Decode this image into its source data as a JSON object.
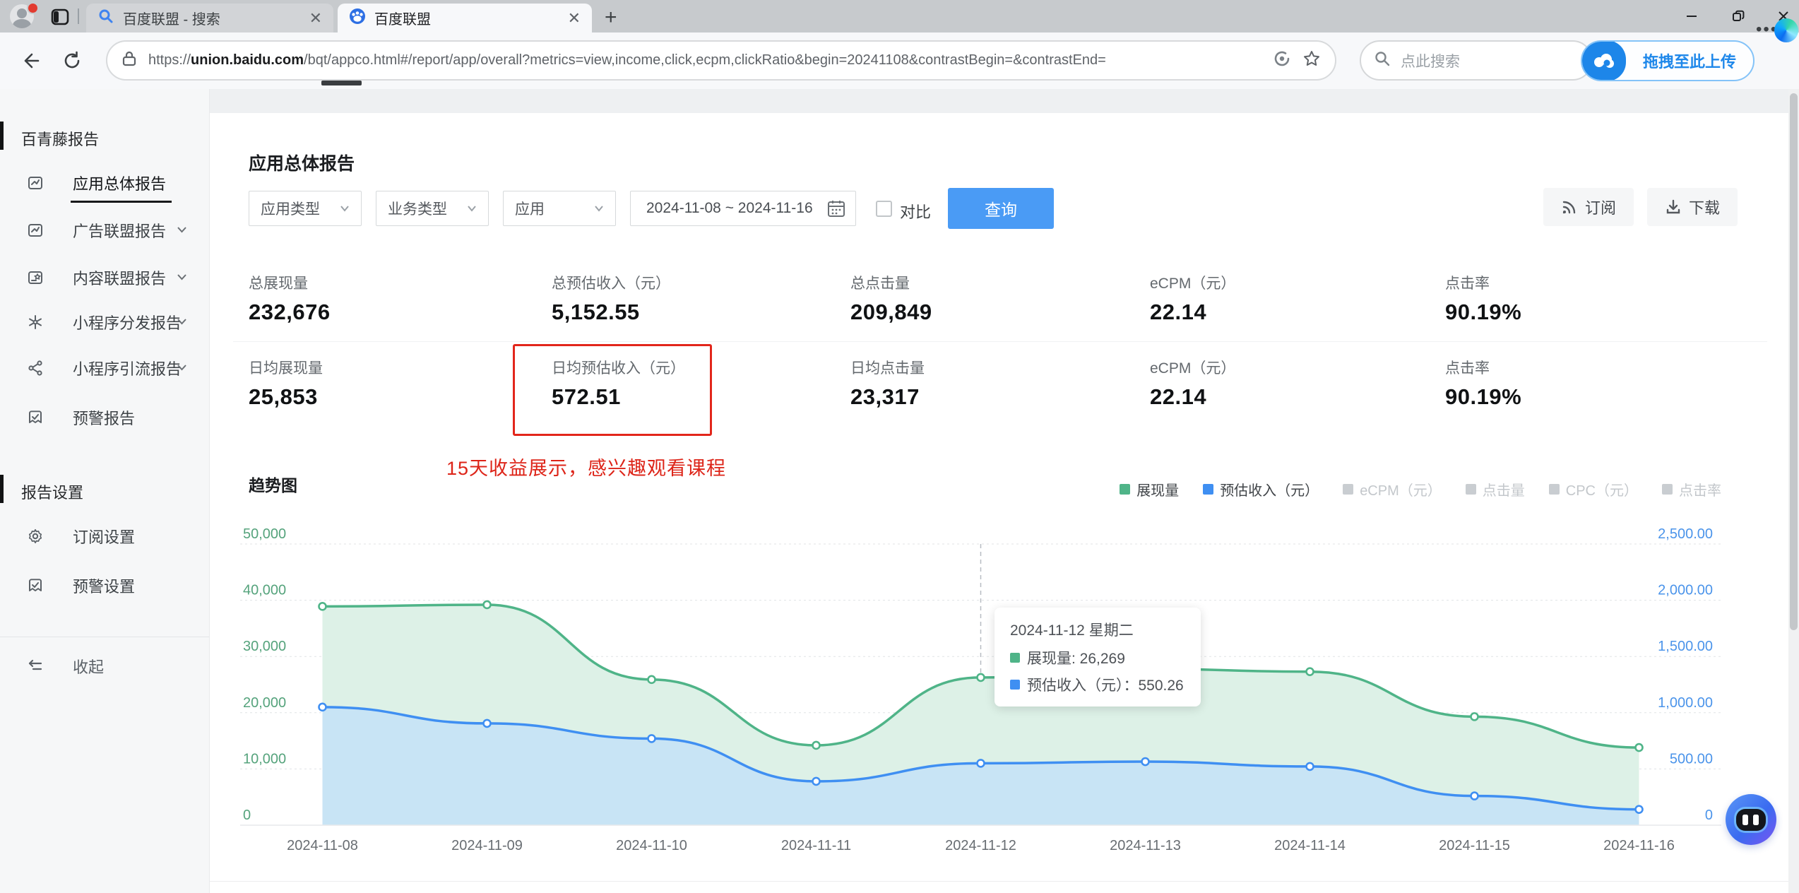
{
  "browser": {
    "tabs": [
      {
        "title": "百度联盟 - 搜索",
        "active": false
      },
      {
        "title": "百度联盟",
        "active": true
      }
    ],
    "url": "https://union.baidu.com/bqt/appco.html#/report/app/overall?metrics=view,income,click,ecpm,clickRatio&begin=20241108&contrastBegin=&contrastEnd=",
    "url_domain": "union.baidu.com",
    "search_placeholder": "点此搜索",
    "upload_label": "拖拽至此上传"
  },
  "sidebar": {
    "section1": "百青藤报告",
    "items": [
      {
        "label": "应用总体报告",
        "active": true,
        "chevron": false,
        "icon": "report-icon"
      },
      {
        "label": "广告联盟报告",
        "active": false,
        "chevron": true,
        "icon": "report-icon"
      },
      {
        "label": "内容联盟报告",
        "active": false,
        "chevron": true,
        "icon": "content-icon"
      },
      {
        "label": "小程序分发报告",
        "active": false,
        "chevron": true,
        "icon": "asterisk-icon"
      },
      {
        "label": "小程序引流报告",
        "active": false,
        "chevron": true,
        "icon": "share-icon"
      },
      {
        "label": "预警报告",
        "active": false,
        "chevron": false,
        "icon": "alert-icon"
      }
    ],
    "section2": "报告设置",
    "settings_items": [
      {
        "label": "订阅设置",
        "icon": "gear-icon"
      },
      {
        "label": "预警设置",
        "icon": "alert-icon"
      }
    ],
    "collapse_label": "收起"
  },
  "page": {
    "title": "应用总体报告",
    "filters": {
      "app_type": "应用类型",
      "biz_type": "业务类型",
      "app": "应用",
      "date_range": "2024-11-08 ~ 2024-11-16",
      "compare_label": "对比",
      "query_label": "查询"
    },
    "actions": {
      "subscribe": "订阅",
      "download": "下载"
    },
    "metrics_row1": [
      {
        "label": "总展现量",
        "value": "232,676"
      },
      {
        "label": "总预估收入（元）",
        "value": "5,152.55"
      },
      {
        "label": "总点击量",
        "value": "209,849"
      },
      {
        "label": "eCPM（元）",
        "value": "22.14"
      },
      {
        "label": "点击率",
        "value": "90.19%"
      }
    ],
    "metrics_row2": [
      {
        "label": "日均展现量",
        "value": "25,853"
      },
      {
        "label": "日均预估收入（元）",
        "value": "572.51",
        "highlighted": true
      },
      {
        "label": "日均点击量",
        "value": "23,317"
      },
      {
        "label": "eCPM（元）",
        "value": "22.14"
      },
      {
        "label": "点击率",
        "value": "90.19%"
      }
    ],
    "annotation": "15天收益展示，感兴趣观看课程",
    "annotation_color": "#dd2418"
  },
  "chart_data": {
    "type": "area",
    "title": "趋势图",
    "x": [
      "2024-11-08",
      "2024-11-09",
      "2024-11-10",
      "2024-11-11",
      "2024-11-12",
      "2024-11-13",
      "2024-11-14",
      "2024-11-15",
      "2024-11-16"
    ],
    "series": [
      {
        "name": "展现量",
        "axis": "left",
        "color": "#4fb488",
        "area_color": "#ddf1e7",
        "values": [
          38900,
          39200,
          25900,
          14200,
          26269,
          27800,
          27300,
          19300,
          13807
        ]
      },
      {
        "name": "预估收入（元）",
        "axis": "right",
        "color": "#3f8ff2",
        "area_color": "#c8e4f5",
        "values": [
          1050,
          905,
          770,
          390,
          550.26,
          565,
          522,
          260,
          140.29
        ]
      }
    ],
    "left_axis": {
      "min": 0,
      "max": 50000,
      "ticks": [
        "50,000",
        "40,000",
        "30,000",
        "20,000",
        "10,000",
        "0"
      ],
      "color": "#55a37c"
    },
    "right_axis": {
      "min": 0,
      "max": 2500,
      "ticks": [
        "2,500.00",
        "2,000.00",
        "1,500.00",
        "1,000.00",
        "500.00",
        "0"
      ],
      "color": "#4b94ea"
    },
    "grid": true,
    "legend_position": "top-right",
    "legend": [
      {
        "label": "展现量",
        "color": "#4fb488",
        "active": true
      },
      {
        "label": "预估收入（元）",
        "color": "#3f8ff2",
        "active": true
      },
      {
        "label": "eCPM（元）",
        "color": "#c9cdd1",
        "active": false
      },
      {
        "label": "点击量",
        "color": "#c9cdd1",
        "active": false
      },
      {
        "label": "CPC（元）",
        "color": "#c9cdd1",
        "active": false
      },
      {
        "label": "点击率",
        "color": "#c9cdd1",
        "active": false
      }
    ],
    "tooltip": {
      "title": "2024-11-12 星期二",
      "rows": [
        {
          "swatch": "#4fb488",
          "text": "展现量: 26,269"
        },
        {
          "swatch": "#3f8ff2",
          "text": "预估收入（元）：550.26"
        }
      ],
      "x_index": 4
    }
  }
}
